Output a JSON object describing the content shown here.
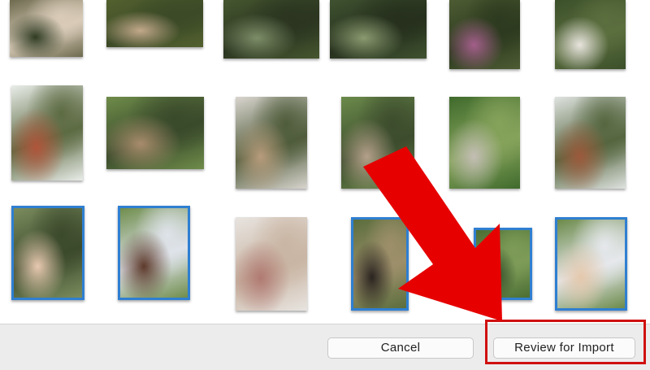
{
  "toolbar": {
    "cancel_label": "Cancel",
    "review_label": "Review for Import"
  },
  "photos": [
    {
      "row": 1,
      "col": 1,
      "selected": false,
      "palette": [
        "#6d6a4e",
        "#2f3b22",
        "#d9cbb8"
      ]
    },
    {
      "row": 1,
      "col": 2,
      "selected": false,
      "palette": [
        "#53612f",
        "#c2a98b",
        "#3c4a27"
      ]
    },
    {
      "row": 1,
      "col": 3,
      "selected": false,
      "palette": [
        "#45562f",
        "#7d8d68",
        "#2b3520"
      ]
    },
    {
      "row": 1,
      "col": 4,
      "selected": false,
      "palette": [
        "#3f5230",
        "#8b9a70",
        "#26301d"
      ]
    },
    {
      "row": 1,
      "col": 5,
      "selected": false,
      "palette": [
        "#4d5c33",
        "#a35f8a",
        "#2d3a1f"
      ]
    },
    {
      "row": 1,
      "col": 6,
      "selected": false,
      "palette": [
        "#3b4f2a",
        "#e8e4de",
        "#5b6e3e"
      ]
    },
    {
      "row": 2,
      "col": 1,
      "selected": false,
      "palette": [
        "#e9ede9",
        "#b0553b",
        "#5d6b43"
      ]
    },
    {
      "row": 2,
      "col": 2,
      "selected": false,
      "palette": [
        "#6f8c4a",
        "#a88c6c",
        "#394a2b"
      ]
    },
    {
      "row": 2,
      "col": 3,
      "selected": false,
      "palette": [
        "#d9d5cf",
        "#b79c7c",
        "#4f5c3b"
      ]
    },
    {
      "row": 2,
      "col": 4,
      "selected": false,
      "palette": [
        "#6b8a4b",
        "#b4a08a",
        "#3c4c2d"
      ]
    },
    {
      "row": 2,
      "col": 5,
      "selected": false,
      "palette": [
        "#3f6a2c",
        "#c3beb4",
        "#86a35b"
      ]
    },
    {
      "row": 2,
      "col": 6,
      "selected": false,
      "palette": [
        "#dfe3e0",
        "#9c5a3c",
        "#55663f"
      ]
    },
    {
      "row": 3,
      "col": 1,
      "selected": true,
      "palette": [
        "#7a8c5e",
        "#e7c9b0",
        "#3c4a2c"
      ]
    },
    {
      "row": 3,
      "col": 2,
      "selected": true,
      "palette": [
        "#6f8d4c",
        "#5d3a2b",
        "#dfe3ea"
      ]
    },
    {
      "row": 3,
      "col": 3,
      "selected": false,
      "palette": [
        "#e8e4e0",
        "#b07a72",
        "#c9b5a3"
      ]
    },
    {
      "row": 3,
      "col": 4,
      "selected": true,
      "palette": [
        "#5b6e3d",
        "#2a2420",
        "#9d8f6a"
      ]
    },
    {
      "row": 3,
      "col": 5,
      "selected": true,
      "palette": [
        "#4b6e34",
        "#2f4826",
        "#7e9c58"
      ]
    },
    {
      "row": 3,
      "col": 6,
      "selected": true,
      "palette": [
        "#6b8a4a",
        "#e4c8ac",
        "#e6e8ec"
      ]
    }
  ],
  "colors": {
    "selection_border": "#2f7fd1",
    "annotation_red": "#e60000",
    "toolbar_bg": "#ececec"
  }
}
